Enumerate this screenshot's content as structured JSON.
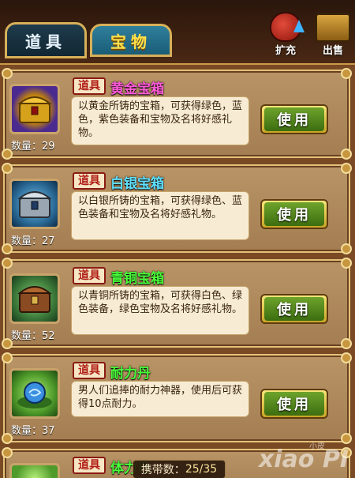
{
  "tabs": [
    {
      "label": "道具"
    },
    {
      "label": "宝物"
    }
  ],
  "top_buttons": {
    "expand_label": "扩充",
    "sell_label": "出售"
  },
  "items": [
    {
      "tag": "道具",
      "name": "黄金宝箱",
      "name_color": "#ff5bd9",
      "desc": "以黄金所铸的宝箱，可获得绿色，蓝色，紫色装备和宝物及名将好感礼物。",
      "qty": "数量：29",
      "use_label": "使用",
      "icon": "gold-chest-icon"
    },
    {
      "tag": "道具",
      "name": "白银宝箱",
      "name_color": "#5ee0ff",
      "desc": "以白银所铸的宝箱，可获得绿色、蓝色装备和宝物及名将好感礼物。",
      "qty": "数量：27",
      "use_label": "使用",
      "icon": "silver-chest-icon"
    },
    {
      "tag": "道具",
      "name": "青铜宝箱",
      "name_color": "#49ff3a",
      "desc": "以青铜所铸的宝箱，可获得白色、绿色装备，绿色宝物及名将好感礼物。",
      "qty": "数量：52",
      "use_label": "使用",
      "icon": "bronze-chest-icon"
    },
    {
      "tag": "道具",
      "name": "耐力丹",
      "name_color": "#49ff3a",
      "desc": "男人们追捧的耐力神器，使用后可获得10点耐力。",
      "qty": "数量：37",
      "use_label": "使用",
      "icon": "stamina-pill-icon"
    },
    {
      "tag": "道具",
      "name": "体力丹",
      "name_color": "#49ff3a",
      "icon": "stamina-pill-icon"
    }
  ],
  "carry": {
    "label": "携带数：",
    "value": "25/35"
  },
  "watermark": {
    "small": "小皮",
    "large": "xiao PI"
  }
}
